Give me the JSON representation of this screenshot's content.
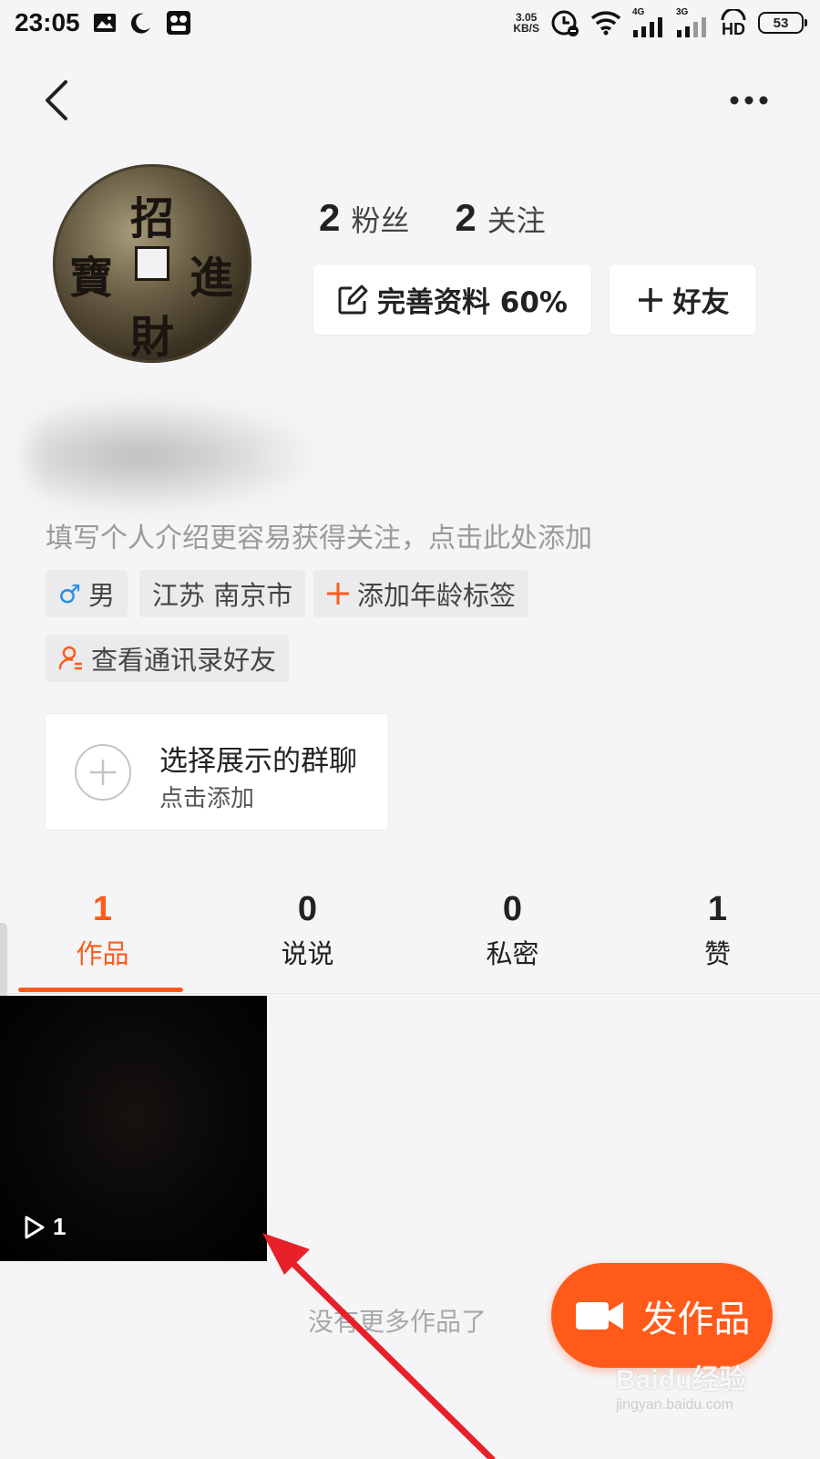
{
  "status_bar": {
    "time": "23:05",
    "net_speed_value": "3.05",
    "net_speed_unit": "KB/S",
    "signal_4g": "4G",
    "signal_3g": "3G",
    "hd_label": "HD",
    "battery": "53",
    "icons": [
      "image-icon",
      "moon-icon",
      "app-notification-icon",
      "alarm-icon",
      "wifi-icon",
      "signal-icon",
      "signal-icon",
      "hd-icon",
      "battery-icon"
    ]
  },
  "nav": {
    "back_icon": "chevron-left-icon",
    "more_icon": "more-dots-icon"
  },
  "profile": {
    "avatar_chars": [
      "招",
      "進",
      "財",
      "寶"
    ],
    "followers_count": "2",
    "followers_label": "粉丝",
    "following_count": "2",
    "following_label": "关注",
    "complete_profile_label": "完善资料 60%",
    "add_friend_label": "好友",
    "intro_placeholder": "填写个人介绍更容易获得关注，点击此处添加"
  },
  "tags": {
    "gender_symbol": "♂",
    "gender": "男",
    "location": "江苏 南京市",
    "add_age": "添加年龄标签",
    "contacts": "查看通讯录好友"
  },
  "group_chat": {
    "title": "选择展示的群聊",
    "subtitle": "点击添加"
  },
  "tabs": [
    {
      "count": "1",
      "label": "作品",
      "active": true
    },
    {
      "count": "0",
      "label": "说说",
      "active": false
    },
    {
      "count": "0",
      "label": "私密",
      "active": false
    },
    {
      "count": "1",
      "label": "赞",
      "active": false
    }
  ],
  "works": {
    "play_count": "1",
    "no_more": "没有更多作品了"
  },
  "fab": {
    "label": "发作品"
  },
  "watermark": {
    "main": "Baidu经验",
    "sub": "jingyan.baidu.com"
  },
  "colors": {
    "accent": "#ff5a1a",
    "annotation_arrow": "#e8202a",
    "background": "#f5f5f7"
  }
}
